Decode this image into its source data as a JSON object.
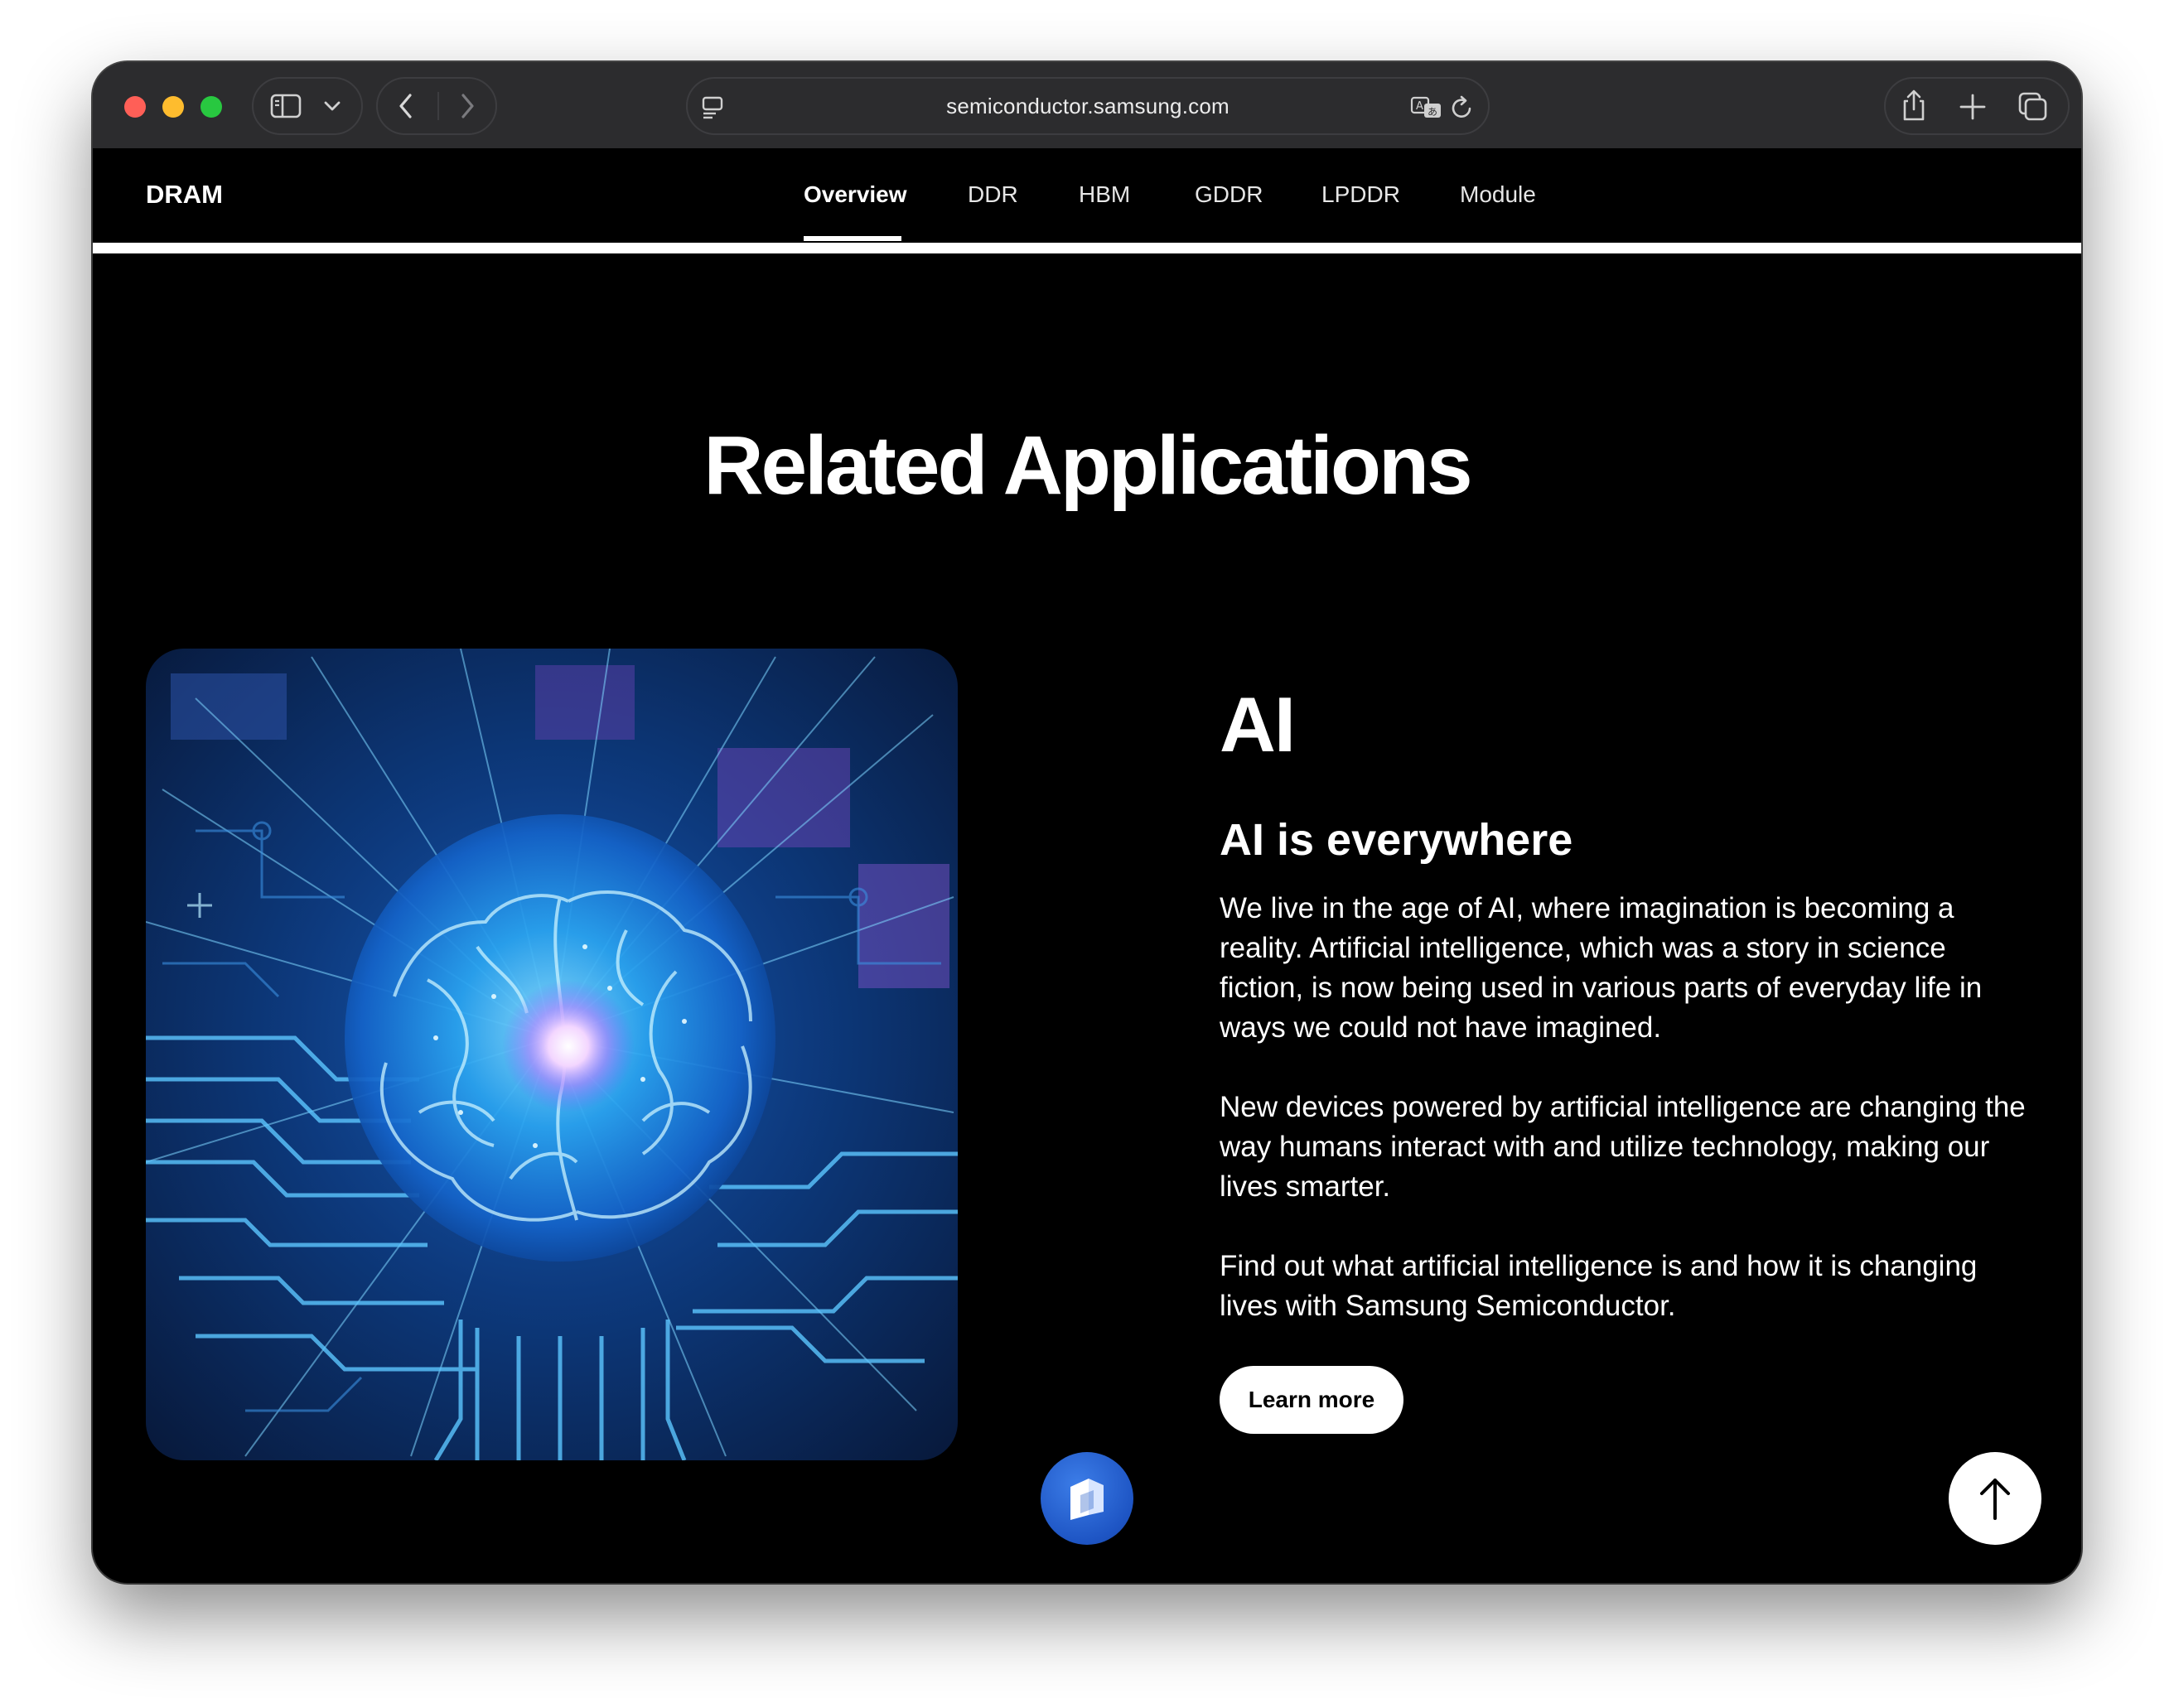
{
  "browser": {
    "url": "semiconductor.samsung.com",
    "icons": [
      "sidebar-icon",
      "chevron-down-icon",
      "back-icon",
      "forward-icon",
      "page-menu-icon",
      "translate-icon",
      "reload-icon",
      "share-icon",
      "new-tab-icon",
      "tab-overview-icon"
    ]
  },
  "nav": {
    "brand": "DRAM",
    "tabs": [
      "Overview",
      "DDR",
      "HBM",
      "GDDR",
      "LPDDR",
      "Module"
    ],
    "active_tab": "Overview"
  },
  "section": {
    "title": "Related Applications"
  },
  "application": {
    "title": "AI",
    "subtitle": "AI is everywhere",
    "paragraphs": [
      "We live in the age of AI, where imagination is becoming a reality. Artificial intelligence, which was a story in science fiction, is now being used in various parts of everyday life in ways we could not have imagined.",
      "New devices powered by artificial intelligence are changing the way humans interact with and utilize technology, making our lives smarter.",
      "Find out what artificial intelligence is and how it is changing lives with Samsung Semiconductor."
    ],
    "cta_label": "Learn more",
    "image": "ai-brain-circuit-image"
  },
  "floating": {
    "logo_icon": "assistant-logo-icon",
    "top_icon": "arrow-up-icon"
  },
  "colors": {
    "page_bg": "#000000",
    "toolbar_bg": "#2c2c2e",
    "text": "#ffffff",
    "logo_blue": "#1e55c4"
  }
}
